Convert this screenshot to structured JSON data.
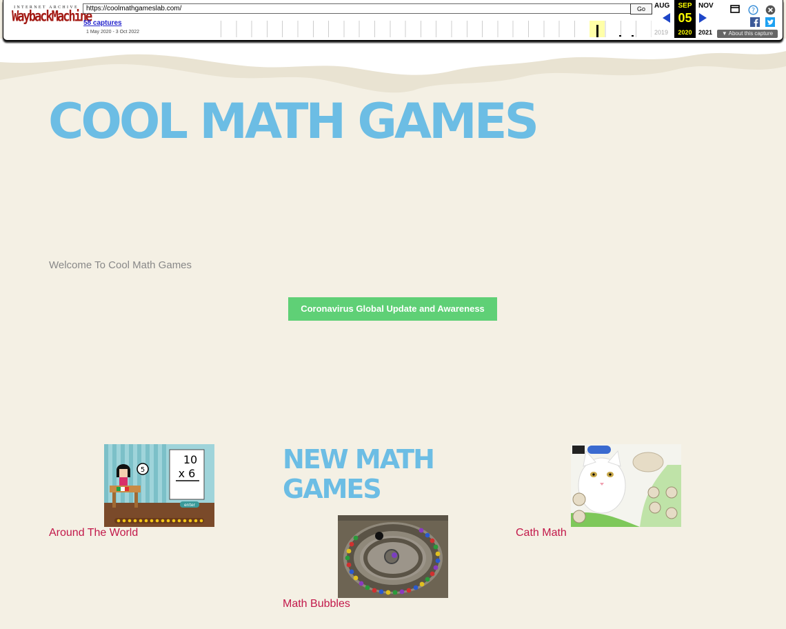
{
  "wayback": {
    "logo_top": "INTERNET ARCHIVE",
    "logo_main": "WaybackMachine",
    "url": "https://coolmathgameslab.com/",
    "go_label": "Go",
    "captures": "58 captures",
    "date_range": "1 May 2020 - 3 Oct 2022",
    "prev_month": "AUG",
    "cur_month": "SEP",
    "next_month": "NOV",
    "cur_day": "05",
    "prev_year": "2019",
    "cur_year": "2020",
    "next_year": "2021",
    "about": "About this capture"
  },
  "page": {
    "site_title": "COOL MATH GAMES",
    "welcome": "Welcome To Cool Math Games",
    "cta_label": "Coronavirus Global Update and Awareness",
    "section_title": "NEW MATH GAMES"
  },
  "games": [
    {
      "title": "Around The World"
    },
    {
      "title": "Math Bubbles"
    },
    {
      "title": "Cath Math"
    }
  ],
  "colors": {
    "background": "#f4f0e4",
    "title_blue": "#6cbde4",
    "button_green": "#5fd076",
    "link_red": "#c2184a"
  }
}
